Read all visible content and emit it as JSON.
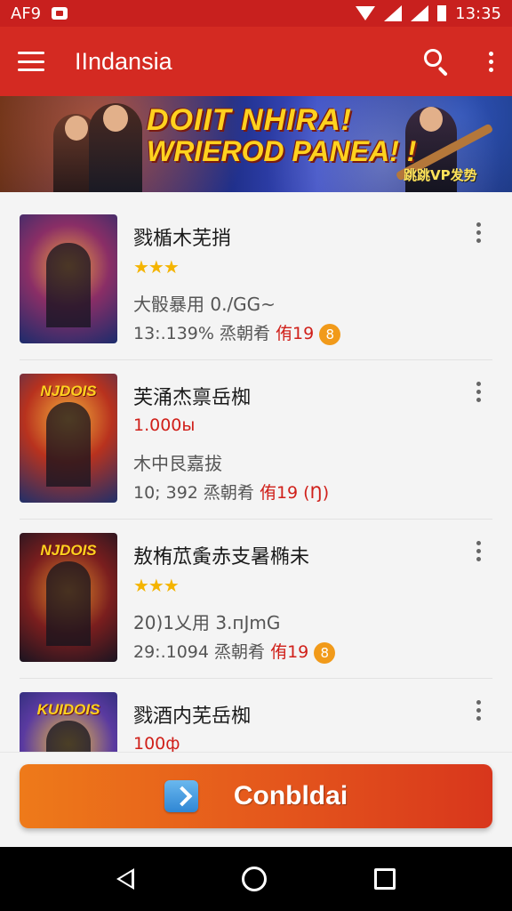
{
  "status_bar": {
    "carrier": "AF9",
    "time": "13:35"
  },
  "app_bar": {
    "title": "IIndansia"
  },
  "banner": {
    "line1": "DOIIT NHIRA!",
    "line2": "WRIEROD PANEA! !",
    "tag": "跳跳VP发势"
  },
  "items": [
    {
      "title": "戮楯木芜捎",
      "rating_stars": "★★★",
      "line2": "大骰暴用 0./GG~",
      "line3_prefix": "13:.139% 烝朝肴 ",
      "line3_red": "侑19",
      "badge": "8"
    },
    {
      "thumb_title": "NJDOIS",
      "title": "芙涌杰禀岳椥",
      "price": "1.000ы",
      "line2": "木中艮嘉拔",
      "line3_prefix": "10; 392 烝朝肴 ",
      "line3_red": "侑19 (Ŋ)"
    },
    {
      "thumb_title": "NJDOIS",
      "title": "敖栯苽夤赤支暑椭未",
      "rating_stars": "★★★",
      "line2": "20)1乂用 3.пJmG",
      "line3_prefix": "29:.1094 烝朝肴 ",
      "line3_red": "侑19",
      "badge": "8"
    },
    {
      "thumb_title": "KUIDOIS",
      "title": "戮酒内芜岳椥",
      "price": "100ф"
    }
  ],
  "download_button": {
    "label": "Conbldai"
  },
  "colors": {
    "app_bar": "#d42a22",
    "accent_red": "#d0201a",
    "star": "#f4b400",
    "button_gradient_start": "#ee7a1a",
    "button_gradient_end": "#d8361c"
  },
  "icons": [
    "hamburger-icon",
    "search-icon",
    "overflow-menu-icon",
    "download-icon",
    "back-icon",
    "home-icon",
    "recents-icon"
  ]
}
